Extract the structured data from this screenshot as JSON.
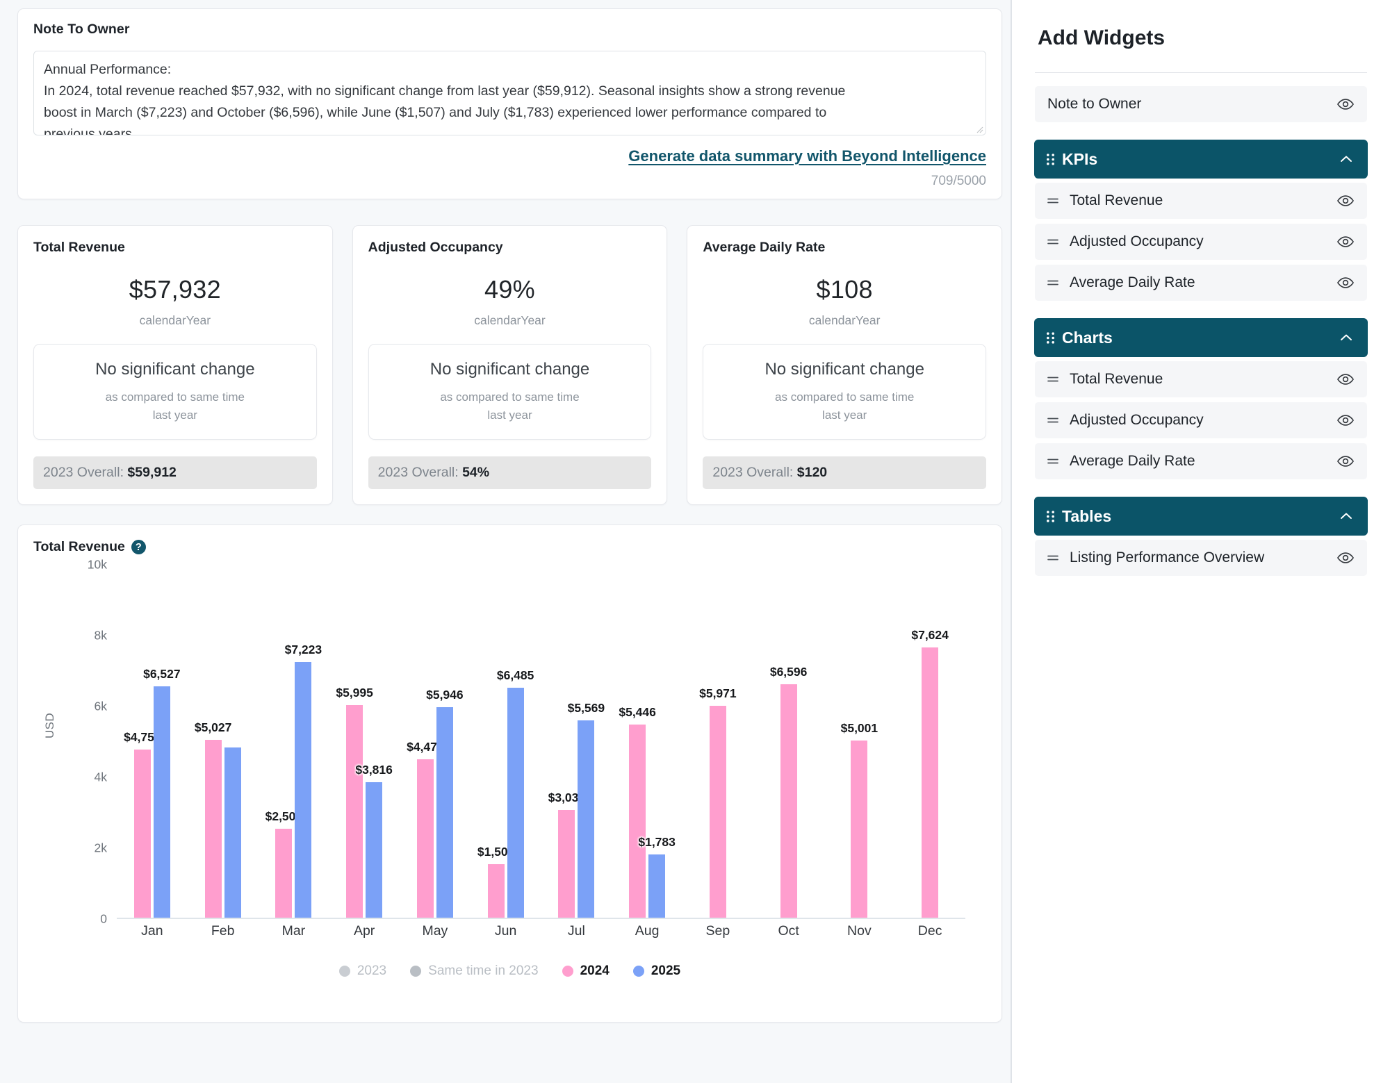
{
  "note": {
    "title": "Note To Owner",
    "body_lines": [
      "Annual Performance:",
      "In 2024, total revenue reached $57,932, with no significant change from last year ($59,912). Seasonal insights show a strong revenue",
      "boost in March ($7,223) and October ($6,596), while June ($1,507) and July ($1,783) experienced lower performance compared to",
      "previous years."
    ],
    "generate_link": "Generate data summary with Beyond Intelligence",
    "char_count": "709/5000"
  },
  "kpis": [
    {
      "title": "Total Revenue",
      "value": "$57,932",
      "period": "calendarYear",
      "change_main": "No significant change",
      "change_sub_line1": "as compared to same time",
      "change_sub_line2": "last year",
      "overall_label": "2023 Overall: ",
      "overall_value": "$59,912"
    },
    {
      "title": "Adjusted Occupancy",
      "value": "49%",
      "period": "calendarYear",
      "change_main": "No significant change",
      "change_sub_line1": "as compared to same time",
      "change_sub_line2": "last year",
      "overall_label": "2023 Overall: ",
      "overall_value": "54%"
    },
    {
      "title": "Average Daily Rate",
      "value": "$108",
      "period": "calendarYear",
      "change_main": "No significant change",
      "change_sub_line1": "as compared to same time",
      "change_sub_line2": "last year",
      "overall_label": "2023 Overall: ",
      "overall_value": "$120"
    }
  ],
  "chart_card": {
    "title": "Total Revenue",
    "help_icon": "?"
  },
  "chart_data": {
    "type": "bar",
    "title": "Total Revenue",
    "xlabel": "",
    "ylabel": "USD",
    "ylim": [
      0,
      10000
    ],
    "yticks": [
      0,
      2000,
      4000,
      6000,
      8000,
      10000
    ],
    "ytick_labels": [
      "0",
      "2k",
      "4k",
      "6k",
      "8k",
      "10k"
    ],
    "grid": false,
    "legend_position": "bottom",
    "categories": [
      "Jan",
      "Feb",
      "Mar",
      "Apr",
      "May",
      "Jun",
      "Jul",
      "Aug",
      "Sep",
      "Oct",
      "Nov",
      "Dec"
    ],
    "series": [
      {
        "name": "2023",
        "color": "#c9cdd2",
        "active": false,
        "values": [
          null,
          null,
          null,
          null,
          null,
          null,
          null,
          null,
          null,
          null,
          null,
          null
        ]
      },
      {
        "name": "Same time in 2023",
        "color": "#b9bec4",
        "active": false,
        "values": [
          null,
          null,
          null,
          null,
          null,
          null,
          null,
          null,
          null,
          null,
          null,
          null
        ]
      },
      {
        "name": "2024",
        "color": "#ff9ece",
        "active": true,
        "values": [
          4754,
          5027,
          2504,
          5995,
          4476,
          1507,
          3032,
          5446,
          5971,
          6596,
          5001,
          7624
        ],
        "labels": [
          "$4,754",
          "$5,027",
          "$2,504",
          "$5,995",
          "$4,476",
          "$1,507",
          "$3,032",
          "$5,446",
          "$5,971",
          "$6,596",
          "$5,001",
          "$7,624"
        ]
      },
      {
        "name": "2025",
        "color": "#7ba1f7",
        "active": true,
        "values": [
          6527,
          4812,
          7223,
          3816,
          5946,
          6485,
          5569,
          1783,
          null,
          null,
          null,
          null
        ],
        "labels": [
          "$6,527",
          null,
          "$7,223",
          "$3,816",
          "$5,946",
          "$6,485",
          "$5,569",
          "$1,783",
          null,
          null,
          null,
          null
        ]
      }
    ]
  },
  "sidebar": {
    "title": "Add Widgets",
    "standalone_items": [
      {
        "label": "Note to Owner",
        "icon": "eye-icon"
      }
    ],
    "groups": [
      {
        "label": "KPIs",
        "collapsed": false,
        "items": [
          {
            "label": "Total Revenue"
          },
          {
            "label": "Adjusted Occupancy"
          },
          {
            "label": "Average Daily Rate"
          }
        ]
      },
      {
        "label": "Charts",
        "collapsed": false,
        "items": [
          {
            "label": "Total Revenue"
          },
          {
            "label": "Adjusted Occupancy"
          },
          {
            "label": "Average Daily Rate"
          }
        ]
      },
      {
        "label": "Tables",
        "collapsed": false,
        "items": [
          {
            "label": "Listing Performance Overview"
          }
        ]
      }
    ]
  },
  "colors": {
    "accent_teal": "#0b5468",
    "link": "#12566b",
    "pink_2024": "#ff9ece",
    "blue_2025": "#7ba1f7",
    "muted": "#9aa1a9"
  }
}
